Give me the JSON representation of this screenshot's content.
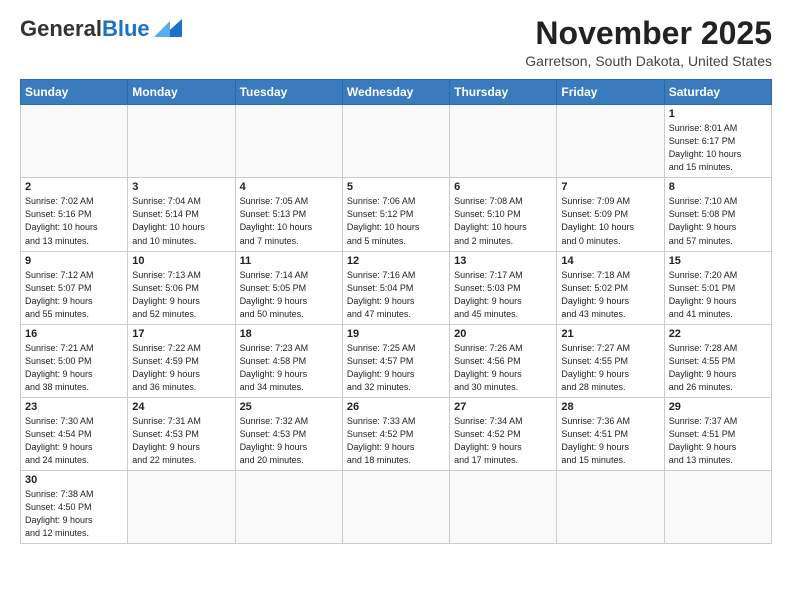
{
  "header": {
    "logo_general": "General",
    "logo_blue": "Blue",
    "month": "November 2025",
    "location": "Garretson, South Dakota, United States"
  },
  "weekdays": [
    "Sunday",
    "Monday",
    "Tuesday",
    "Wednesday",
    "Thursday",
    "Friday",
    "Saturday"
  ],
  "weeks": [
    [
      {
        "day": "",
        "info": ""
      },
      {
        "day": "",
        "info": ""
      },
      {
        "day": "",
        "info": ""
      },
      {
        "day": "",
        "info": ""
      },
      {
        "day": "",
        "info": ""
      },
      {
        "day": "",
        "info": ""
      },
      {
        "day": "1",
        "info": "Sunrise: 8:01 AM\nSunset: 6:17 PM\nDaylight: 10 hours\nand 15 minutes."
      }
    ],
    [
      {
        "day": "2",
        "info": "Sunrise: 7:02 AM\nSunset: 5:16 PM\nDaylight: 10 hours\nand 13 minutes."
      },
      {
        "day": "3",
        "info": "Sunrise: 7:04 AM\nSunset: 5:14 PM\nDaylight: 10 hours\nand 10 minutes."
      },
      {
        "day": "4",
        "info": "Sunrise: 7:05 AM\nSunset: 5:13 PM\nDaylight: 10 hours\nand 7 minutes."
      },
      {
        "day": "5",
        "info": "Sunrise: 7:06 AM\nSunset: 5:12 PM\nDaylight: 10 hours\nand 5 minutes."
      },
      {
        "day": "6",
        "info": "Sunrise: 7:08 AM\nSunset: 5:10 PM\nDaylight: 10 hours\nand 2 minutes."
      },
      {
        "day": "7",
        "info": "Sunrise: 7:09 AM\nSunset: 5:09 PM\nDaylight: 10 hours\nand 0 minutes."
      },
      {
        "day": "8",
        "info": "Sunrise: 7:10 AM\nSunset: 5:08 PM\nDaylight: 9 hours\nand 57 minutes."
      }
    ],
    [
      {
        "day": "9",
        "info": "Sunrise: 7:12 AM\nSunset: 5:07 PM\nDaylight: 9 hours\nand 55 minutes."
      },
      {
        "day": "10",
        "info": "Sunrise: 7:13 AM\nSunset: 5:06 PM\nDaylight: 9 hours\nand 52 minutes."
      },
      {
        "day": "11",
        "info": "Sunrise: 7:14 AM\nSunset: 5:05 PM\nDaylight: 9 hours\nand 50 minutes."
      },
      {
        "day": "12",
        "info": "Sunrise: 7:16 AM\nSunset: 5:04 PM\nDaylight: 9 hours\nand 47 minutes."
      },
      {
        "day": "13",
        "info": "Sunrise: 7:17 AM\nSunset: 5:03 PM\nDaylight: 9 hours\nand 45 minutes."
      },
      {
        "day": "14",
        "info": "Sunrise: 7:18 AM\nSunset: 5:02 PM\nDaylight: 9 hours\nand 43 minutes."
      },
      {
        "day": "15",
        "info": "Sunrise: 7:20 AM\nSunset: 5:01 PM\nDaylight: 9 hours\nand 41 minutes."
      }
    ],
    [
      {
        "day": "16",
        "info": "Sunrise: 7:21 AM\nSunset: 5:00 PM\nDaylight: 9 hours\nand 38 minutes."
      },
      {
        "day": "17",
        "info": "Sunrise: 7:22 AM\nSunset: 4:59 PM\nDaylight: 9 hours\nand 36 minutes."
      },
      {
        "day": "18",
        "info": "Sunrise: 7:23 AM\nSunset: 4:58 PM\nDaylight: 9 hours\nand 34 minutes."
      },
      {
        "day": "19",
        "info": "Sunrise: 7:25 AM\nSunset: 4:57 PM\nDaylight: 9 hours\nand 32 minutes."
      },
      {
        "day": "20",
        "info": "Sunrise: 7:26 AM\nSunset: 4:56 PM\nDaylight: 9 hours\nand 30 minutes."
      },
      {
        "day": "21",
        "info": "Sunrise: 7:27 AM\nSunset: 4:55 PM\nDaylight: 9 hours\nand 28 minutes."
      },
      {
        "day": "22",
        "info": "Sunrise: 7:28 AM\nSunset: 4:55 PM\nDaylight: 9 hours\nand 26 minutes."
      }
    ],
    [
      {
        "day": "23",
        "info": "Sunrise: 7:30 AM\nSunset: 4:54 PM\nDaylight: 9 hours\nand 24 minutes."
      },
      {
        "day": "24",
        "info": "Sunrise: 7:31 AM\nSunset: 4:53 PM\nDaylight: 9 hours\nand 22 minutes."
      },
      {
        "day": "25",
        "info": "Sunrise: 7:32 AM\nSunset: 4:53 PM\nDaylight: 9 hours\nand 20 minutes."
      },
      {
        "day": "26",
        "info": "Sunrise: 7:33 AM\nSunset: 4:52 PM\nDaylight: 9 hours\nand 18 minutes."
      },
      {
        "day": "27",
        "info": "Sunrise: 7:34 AM\nSunset: 4:52 PM\nDaylight: 9 hours\nand 17 minutes."
      },
      {
        "day": "28",
        "info": "Sunrise: 7:36 AM\nSunset: 4:51 PM\nDaylight: 9 hours\nand 15 minutes."
      },
      {
        "day": "29",
        "info": "Sunrise: 7:37 AM\nSunset: 4:51 PM\nDaylight: 9 hours\nand 13 minutes."
      }
    ],
    [
      {
        "day": "30",
        "info": "Sunrise: 7:38 AM\nSunset: 4:50 PM\nDaylight: 9 hours\nand 12 minutes."
      },
      {
        "day": "",
        "info": ""
      },
      {
        "day": "",
        "info": ""
      },
      {
        "day": "",
        "info": ""
      },
      {
        "day": "",
        "info": ""
      },
      {
        "day": "",
        "info": ""
      },
      {
        "day": "",
        "info": ""
      }
    ]
  ]
}
